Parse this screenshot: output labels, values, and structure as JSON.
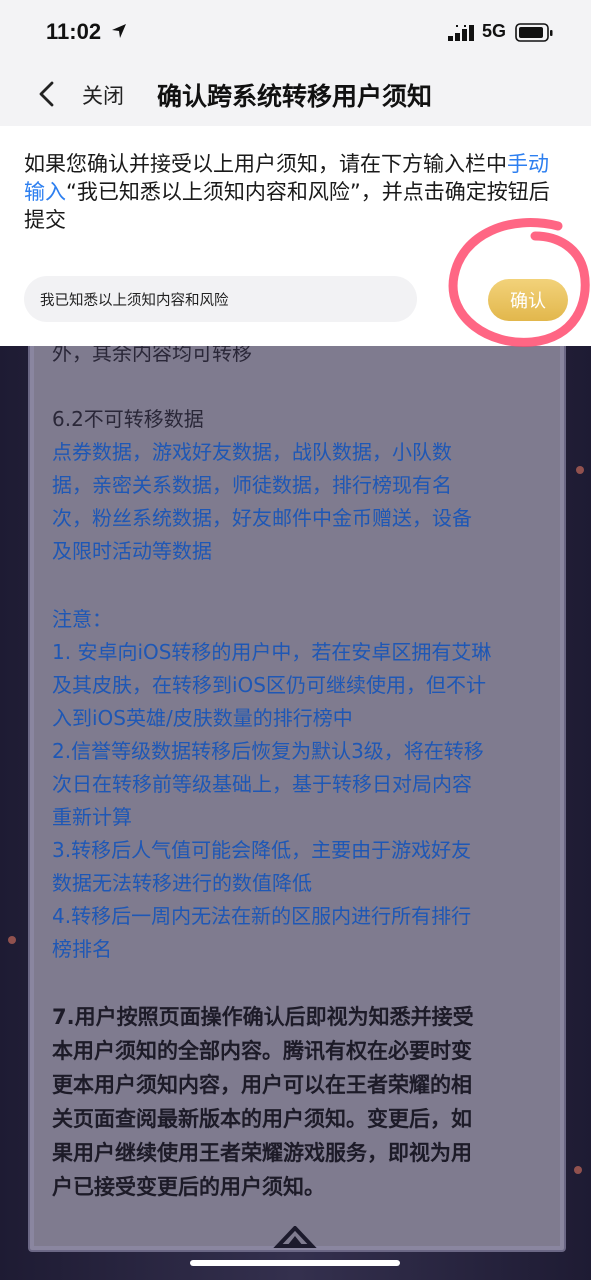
{
  "status_bar": {
    "time": "11:02",
    "network": "5G",
    "icons": [
      "location-arrow-icon",
      "signal-icon",
      "battery-icon"
    ]
  },
  "nav": {
    "close_label": "关闭",
    "title": "确认跨系统转移用户须知",
    "back_icon": "chevron-left-icon"
  },
  "confirm_panel": {
    "instruction_before": "如果您确认并接受以上用户须知，请在下方输入栏中",
    "instruction_link": "手动输入",
    "instruction_after": "“我已知悉以上须知内容和风险”，并点击确定按钮后提交",
    "input_value": "我已知悉以上须知内容和风险",
    "confirm_label": "确认",
    "link_color": "#2d7ff0",
    "button_color": "#e6bf5a",
    "annotation_color": "#ff4b6e"
  },
  "document": {
    "partial_line": "外，其余内容均可转移",
    "section_title": "6.2不可转移数据",
    "section_body": [
      "点券数据，游戏好友数据，战队数据，小队数",
      "据，亲密关系数据，师徒数据，排行榜现有名",
      "次，粉丝系统数据，好友邮件中金币赠送，设备",
      "及限时活动等数据"
    ],
    "notice_title": "注意：",
    "notices": [
      [
        "1. 安卓向iOS转移的用户中，若在安卓区拥有艾琳",
        "及其皮肤，在转移到iOS区仍可继续使用，但不计",
        "入到iOS英雄/皮肤数量的排行榜中"
      ],
      [
        "2.信誉等级数据转移后恢复为默认3级，将在转移",
        "次日在转移前等级基础上，基于转移日对局内容",
        "重新计算"
      ],
      [
        "3.转移后人气值可能会降低，主要由于游戏好友",
        "数据无法转移进行的数值降低"
      ],
      [
        "4.转移后一周内无法在新的区服内进行所有排行",
        "榜排名"
      ]
    ],
    "clause_7": [
      "7.用户按照页面操作确认后即视为知悉并接受",
      "本用户须知的全部内容。腾讯有权在必要时变",
      "更本用户须知内容，用户可以在王者荣耀的相",
      "关页面查阅最新版本的用户须知。变更后，如",
      "果用户继续使用王者荣耀游戏服务，即视为用",
      "户已接受变更后的用户须知。"
    ]
  }
}
